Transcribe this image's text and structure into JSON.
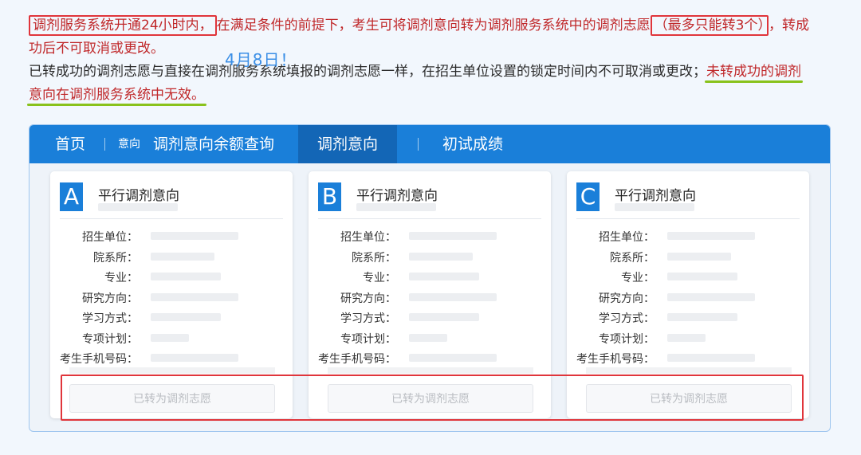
{
  "notice": {
    "boxed_1": "调剂服务系统开通24小时内，",
    "text_1": "在满足条件的前提下，考生可将调剂意向转为调剂服务系统中的调剂志愿",
    "boxed_2": "（最多只能转3个）",
    "text_2": "，转成",
    "line2": "功后不可取消或更改。",
    "date_note": "4月8日！",
    "line3_dark": "已转成功的调剂志愿与直接在调剂服务系统填报的调剂志愿一样，在招生单位设置的锁定时间内不可取消或更改；",
    "line3_red": "未转成功的调剂",
    "line4_red": "意向在调剂服务系统中无效。"
  },
  "nav": {
    "home": "首页",
    "small": "意向",
    "balance": "调剂意向余额查询",
    "intent": "调剂意向",
    "scores": "初试成绩"
  },
  "card_title": "平行调剂意向",
  "fields": {
    "school": "招生单位：",
    "dept": "院系所：",
    "major": "专业：",
    "direction": "研究方向：",
    "mode": "学习方式：",
    "plan": "专项计划：",
    "phone": "考生手机号码："
  },
  "cards": [
    {
      "letter": "A",
      "button": "已转为调剂志愿"
    },
    {
      "letter": "B",
      "button": "已转为调剂志愿"
    },
    {
      "letter": "C",
      "button": "已转为调剂志愿"
    }
  ],
  "colors": {
    "accent": "#1a7fd9",
    "active_tab": "#1366b6",
    "highlight_red": "#e0353b",
    "underline_green": "#89c21c"
  }
}
